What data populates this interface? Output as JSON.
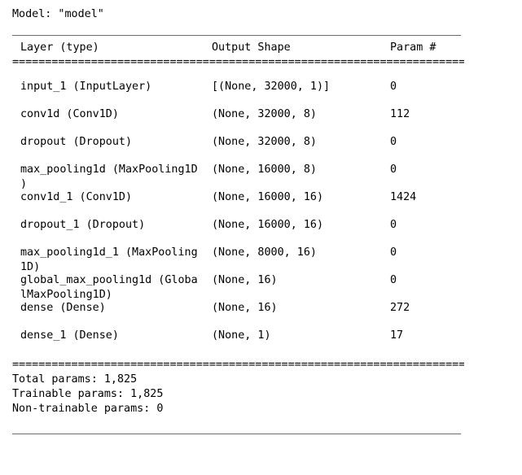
{
  "model": {
    "title": "Model: \"model\""
  },
  "table": {
    "headers": {
      "layer": "Layer (type)",
      "shape": "Output Shape",
      "param": "Param #"
    },
    "separator": "=====================================================================",
    "rows": [
      {
        "layer_line1": "input_1 (InputLayer)",
        "layer_line2": "",
        "shape": "[(None, 32000, 1)]",
        "param": "0"
      },
      {
        "layer_line1": "conv1d (Conv1D)",
        "layer_line2": "",
        "shape": "(None, 32000, 8)",
        "param": "112"
      },
      {
        "layer_line1": "dropout (Dropout)",
        "layer_line2": "",
        "shape": "(None, 32000, 8)",
        "param": "0"
      },
      {
        "layer_line1": "max_pooling1d (MaxPooling1D",
        "layer_line2": ")",
        "shape": "(None, 16000, 8)",
        "param": "0"
      },
      {
        "layer_line1": "conv1d_1 (Conv1D)",
        "layer_line2": "",
        "shape": "(None, 16000, 16)",
        "param": "1424"
      },
      {
        "layer_line1": "dropout_1 (Dropout)",
        "layer_line2": "",
        "shape": "(None, 16000, 16)",
        "param": "0"
      },
      {
        "layer_line1": "max_pooling1d_1 (MaxPooling",
        "layer_line2": "1D)",
        "shape": "(None, 8000, 16)",
        "param": "0"
      },
      {
        "layer_line1": "global_max_pooling1d (Globa",
        "layer_line2": "lMaxPooling1D)",
        "shape": "(None, 16)",
        "param": "0"
      },
      {
        "layer_line1": "dense (Dense)",
        "layer_line2": "",
        "shape": "(None, 16)",
        "param": "272"
      },
      {
        "layer_line1": "dense_1 (Dense)",
        "layer_line2": "",
        "shape": "(None, 1)",
        "param": "17"
      }
    ]
  },
  "totals": {
    "separator": "=====================================================================",
    "total_params": "Total params: 1,825",
    "trainable_params": "Trainable params: 1,825",
    "non_trainable_params": "Non-trainable params: 0"
  },
  "colors": {
    "text": "#000000",
    "rule": "#6b6b6b",
    "background": "#ffffff"
  }
}
